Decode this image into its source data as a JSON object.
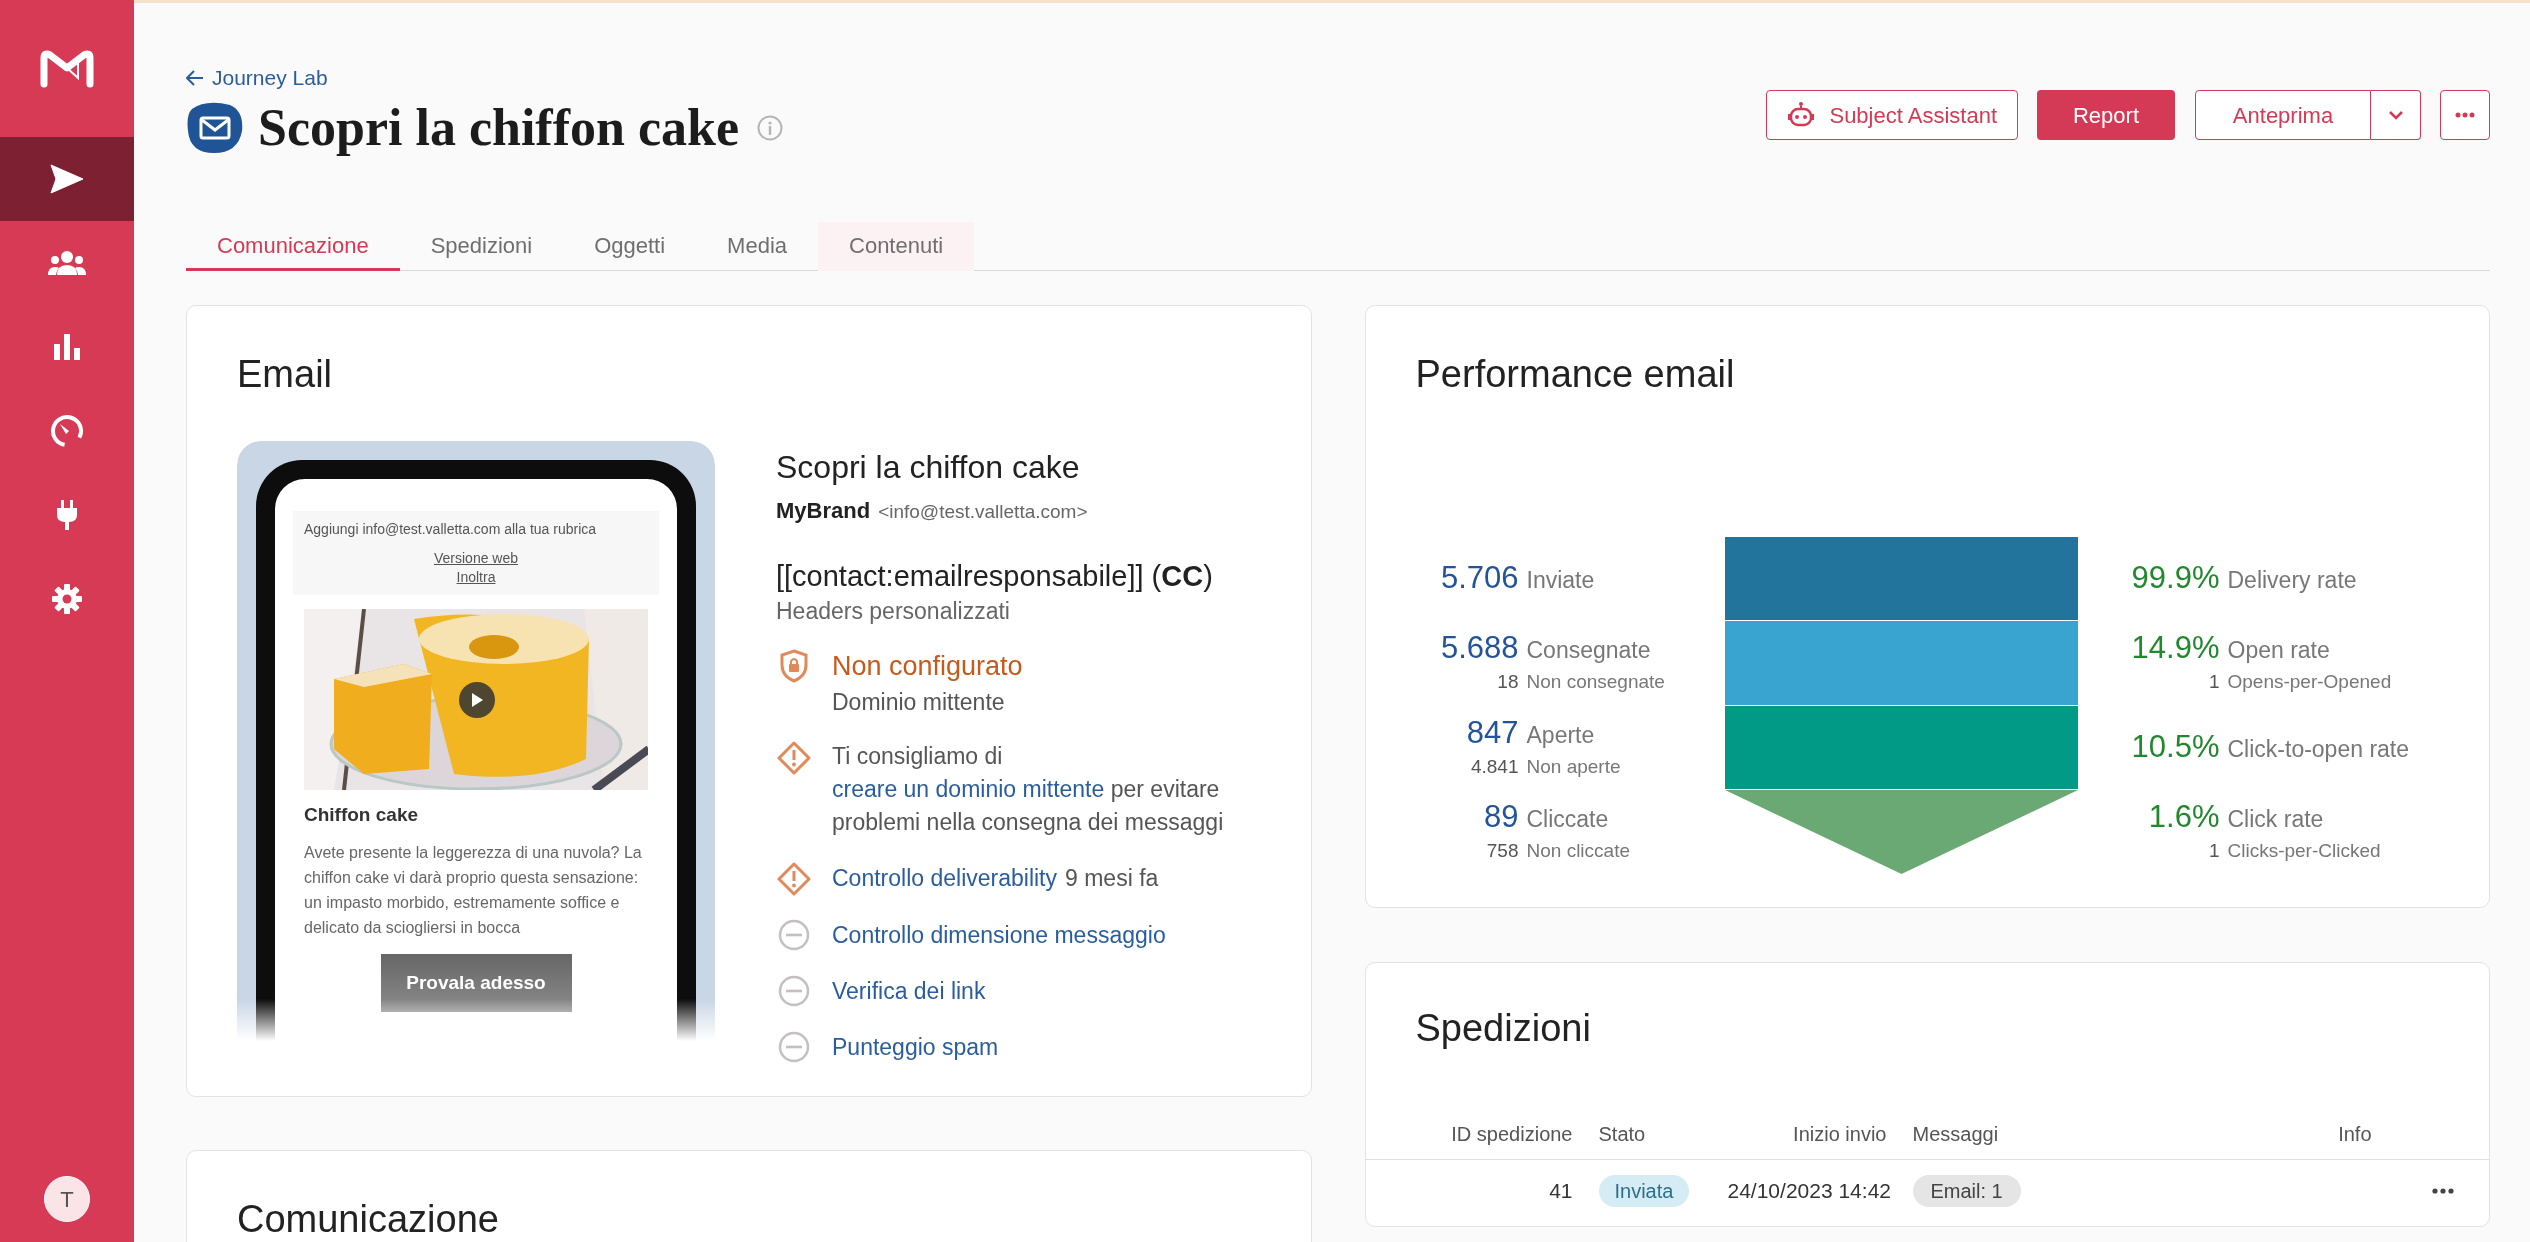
{
  "sidebar": {
    "items": [
      {
        "kind": "send",
        "selected": true
      },
      {
        "kind": "people",
        "selected": false
      },
      {
        "kind": "chart",
        "selected": false
      },
      {
        "kind": "gauge",
        "selected": false
      },
      {
        "kind": "plug",
        "selected": false
      },
      {
        "kind": "gear",
        "selected": false
      }
    ],
    "avatar": "T"
  },
  "header": {
    "back_link": "Journey Lab",
    "title": "Scopri la chiffon cake",
    "buttons": [
      {
        "kind": "assistant",
        "label": "Subject Assistant"
      },
      {
        "kind": "primary",
        "label": "Report"
      },
      {
        "kind": "split",
        "label": "Anteprima"
      },
      {
        "kind": "more"
      }
    ]
  },
  "tabs": [
    {
      "label": "Comunicazione",
      "selected": true,
      "hovered": false
    },
    {
      "label": "Spedizioni",
      "selected": false,
      "hovered": false
    },
    {
      "label": "Oggetti",
      "selected": false,
      "hovered": false
    },
    {
      "label": "Media",
      "selected": false,
      "hovered": false
    },
    {
      "label": "Contenuti",
      "selected": false,
      "hovered": true
    }
  ],
  "email_card": {
    "title": "Email",
    "preview": {
      "top_note": "Aggiungi info@test.valletta.com alla tua rubrica",
      "links": [
        "Versione web",
        "Inoltra"
      ],
      "heading": "Chiffon cake",
      "body": "Avete presente la leggerezza di una nuvola? La chiffon cake vi darà proprio questa sensazione: un impasto morbido, estremamente soffice e delicato da sciogliersi in bocca",
      "cta": "Provala adesso"
    },
    "subject": "Scopri la chiffon cake",
    "sender_name": "MyBrand",
    "sender_address": "<info@test.valletta.com>",
    "cc": "[[contact:emailresponsabile]] (**CC**)",
    "headers_note": "Headers personalizzati",
    "checks": [
      {
        "kind": "domain",
        "warning": true,
        "title": "Non configurato",
        "subtitle": "Dominio mittente"
      },
      {
        "kind": "advice",
        "warning": true,
        "before": "Ti consigliamo di ",
        "link": "creare un dominio mittente",
        "after": " per evitare problemi nella consegna dei messaggi"
      },
      {
        "kind": "check",
        "warning": true,
        "link": "Controllo deliverability",
        "note": "9 mesi fa"
      },
      {
        "kind": "check",
        "warning": false,
        "link": "Controllo dimensione messaggio"
      },
      {
        "kind": "check",
        "warning": false,
        "link": "Verifica dei link"
      },
      {
        "kind": "check",
        "warning": false,
        "link": "Punteggio spam"
      }
    ]
  },
  "performance_card": {
    "title": "Performance email",
    "counts": [
      {
        "value": "5.706",
        "label": "Inviate"
      },
      {
        "value": "5.688",
        "label": "Consegnate",
        "sub_value": "18",
        "sub_label": "Non consegnate"
      },
      {
        "value": "847",
        "label": "Aperte",
        "sub_value": "4.841",
        "sub_label": "Non aperte"
      },
      {
        "value": "89",
        "label": "Cliccate",
        "sub_value": "758",
        "sub_label": "Non cliccate"
      }
    ],
    "rates": [
      {
        "value": "99.9%",
        "label": "Delivery rate"
      },
      {
        "value": "14.9%",
        "label": "Open rate",
        "sub_value": "1",
        "sub_label": "Opens-per-Opened"
      },
      {
        "value": "10.5%",
        "label": "Click-to-open rate"
      },
      {
        "value": "1.6%",
        "label": "Click rate",
        "sub_value": "1",
        "sub_label": "Clicks-per-Clicked"
      }
    ]
  },
  "shipments_card": {
    "title": "Spedizioni",
    "columns": [
      "ID spedizione",
      "Stato",
      "Inizio invio",
      "Messaggi",
      "Info"
    ],
    "rows": [
      {
        "id": "41",
        "status": "Inviata",
        "start": "24/10/2023 14:42",
        "messages": "Email: 1"
      }
    ]
  },
  "communication_card": {
    "title": "Comunicazione"
  }
}
